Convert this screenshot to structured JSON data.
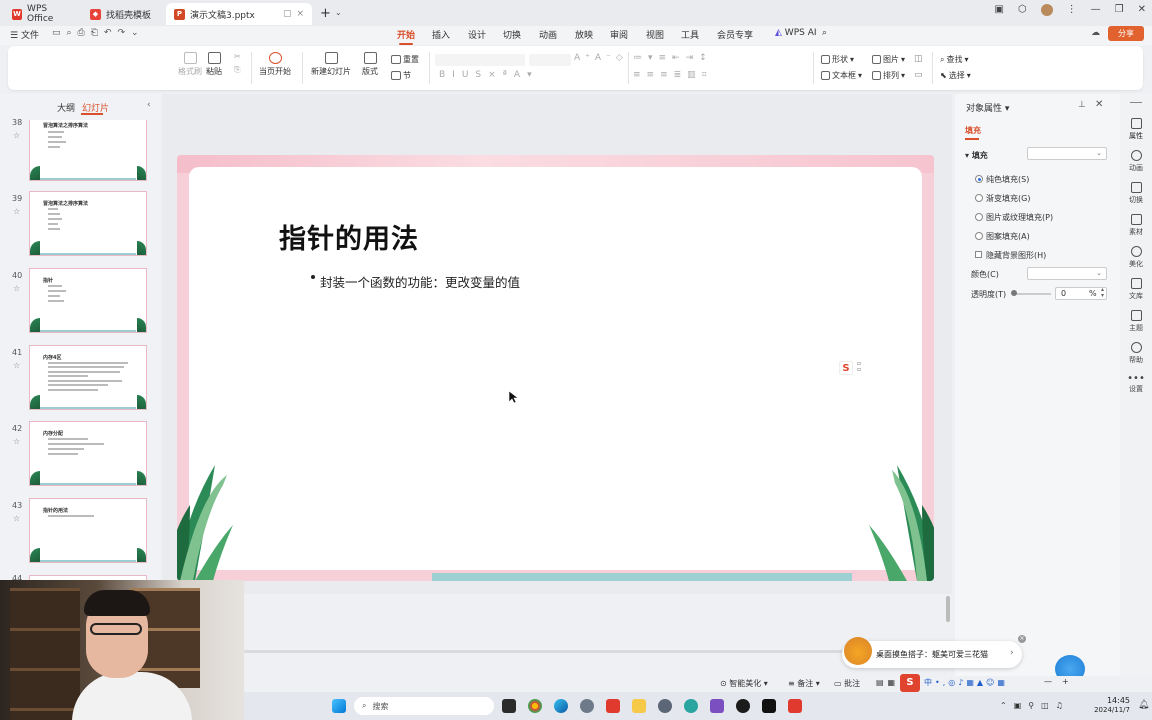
{
  "titlebar": {
    "tabs": [
      {
        "label": "WPS Office",
        "icon": "wps-logo-icon"
      },
      {
        "label": "找稻壳模板",
        "icon": "docer-icon"
      },
      {
        "label": "演示文稿3.pptx",
        "icon": "ppt-file-icon"
      }
    ],
    "new_tab_symbol": "+"
  },
  "menubar": {
    "file_label": "文件",
    "items": [
      "开始",
      "插入",
      "设计",
      "切换",
      "动画",
      "放映",
      "审阅",
      "视图",
      "工具",
      "会员专享",
      "WPS AI"
    ],
    "active_index": 0,
    "share_label": "分享"
  },
  "ribbon": {
    "format_painter": "格式刷",
    "paste": "粘贴",
    "play_from_current": "当页开始",
    "new_slide": "新建幻灯片",
    "layout": "版式",
    "reset": "重置",
    "section": "节",
    "shape": "形状",
    "textbox": "文本框",
    "picture": "图片",
    "arrange": "排列",
    "find": "查找",
    "select": "选择"
  },
  "left_panel": {
    "tab_outline": "大纲",
    "tab_slides": "幻灯片",
    "slides": [
      {
        "num": "38",
        "title": "冒泡算法之排序算法"
      },
      {
        "num": "39",
        "title": "冒泡算法之排序算法"
      },
      {
        "num": "40",
        "title": "指针"
      },
      {
        "num": "41",
        "title": "内存4区"
      },
      {
        "num": "42",
        "title": "内存分配"
      },
      {
        "num": "43",
        "title": "指针的用法"
      },
      {
        "num": "44",
        "title": ""
      }
    ]
  },
  "slide": {
    "title": "指针的用法",
    "bullet": "封装一个函数的功能：更改变量的值"
  },
  "right_panel": {
    "header": "对象属性",
    "tab_fill": "填充",
    "section_fill": "填充",
    "options": [
      "纯色填充(S)",
      "渐变填充(G)",
      "图片或纹理填充(P)",
      "图案填充(A)"
    ],
    "selected_option": 0,
    "hide_bg_label": "隐藏背景图形(H)",
    "color_label": "颜色(C)",
    "transparency_label": "透明度(T)",
    "transparency_value": "0",
    "transparency_unit": "%"
  },
  "right_sidebar": [
    "属性",
    "动画",
    "切换",
    "素材",
    "美化",
    "文库",
    "主题",
    "帮助",
    "设置"
  ],
  "statusbar": {
    "beautify": "智能美化",
    "notes": "备注",
    "comments": "批注"
  },
  "notification": {
    "text": "桌面摸鱼搭子：躯美可爱三花猫"
  },
  "taskbar": {
    "search_placeholder": "搜索",
    "time": "14:45",
    "date": "2024/11/7"
  },
  "colors": {
    "accent": "#d9502a",
    "slide_pink": "#f7cfd8",
    "slide_teal": "#9dd0d3",
    "leaf_green": "#2b8a56"
  }
}
